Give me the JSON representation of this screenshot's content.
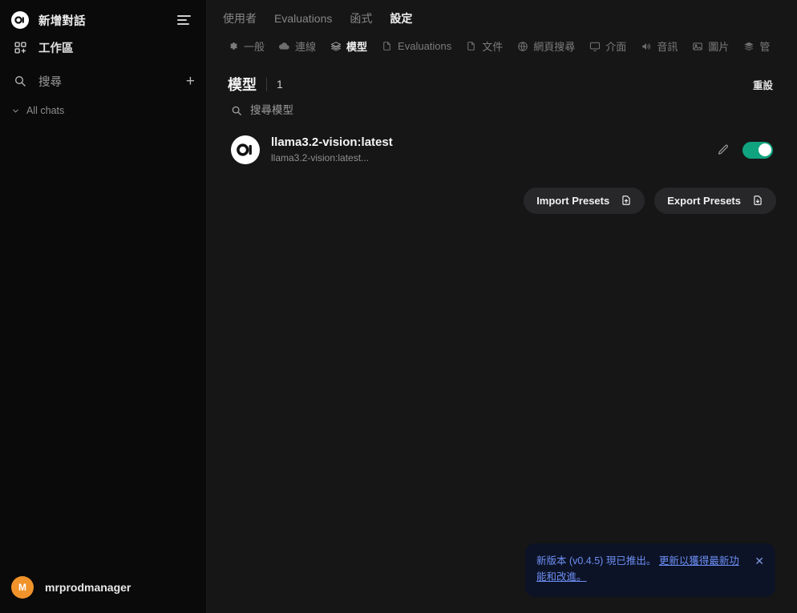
{
  "sidebar": {
    "new_chat": {
      "label": "新增對話",
      "icon": "openwebui-logo-icon",
      "menu_icon": "panel-toggle-icon"
    },
    "workspace": {
      "label": "工作區",
      "icon": "workspace-grid-icon"
    },
    "search": {
      "label": "搜尋",
      "icon": "search-icon",
      "add_icon": "plus-icon"
    },
    "all_chats": {
      "label": "All chats",
      "icon": "chevron-down-icon"
    },
    "user": {
      "name": "mrprodmanager",
      "initial": "M",
      "avatar_color": "#f0932b"
    }
  },
  "main": {
    "primary_tabs": [
      {
        "label": "使用者",
        "active": false
      },
      {
        "label": "Evaluations",
        "active": false
      },
      {
        "label": "函式",
        "active": false
      },
      {
        "label": "設定",
        "active": true
      }
    ],
    "secondary_tabs": [
      {
        "label": "一般",
        "icon": "gear-icon",
        "active": false
      },
      {
        "label": "連線",
        "icon": "cloud-icon",
        "active": false
      },
      {
        "label": "模型",
        "icon": "layers-icon",
        "active": true
      },
      {
        "label": "Evaluations",
        "icon": "document-icon",
        "active": false
      },
      {
        "label": "文件",
        "icon": "document-icon",
        "active": false
      },
      {
        "label": "網頁搜尋",
        "icon": "globe-icon",
        "active": false
      },
      {
        "label": "介面",
        "icon": "monitor-icon",
        "active": false
      },
      {
        "label": "音訊",
        "icon": "speaker-icon",
        "active": false
      },
      {
        "label": "圖片",
        "icon": "image-icon",
        "active": false
      },
      {
        "label": "管",
        "icon": "layers-icon",
        "active": false
      }
    ],
    "section": {
      "title": "模型",
      "count": "1",
      "reset_label": "重設"
    },
    "search": {
      "placeholder": "搜尋模型",
      "value": "",
      "icon": "search-icon"
    },
    "models": [
      {
        "name": "llama3.2-vision:latest",
        "subtitle": "llama3.2-vision:latest...",
        "avatar_icon": "openwebui-logo-icon",
        "edit_icon": "pencil-icon",
        "enabled": true,
        "toggle_color": "#10a37f"
      }
    ],
    "presets": {
      "import_label": "Import Presets",
      "import_icon": "file-upload-icon",
      "export_label": "Export Presets",
      "export_icon": "file-download-icon"
    }
  },
  "toast": {
    "text_before": "新版本 (v0.4.5) 現已推出。",
    "link_text": "更新以獲得最新功能和改進。",
    "close_icon": "close-icon",
    "accent_color": "#6c8ff5",
    "background_color": "#0d1326"
  }
}
